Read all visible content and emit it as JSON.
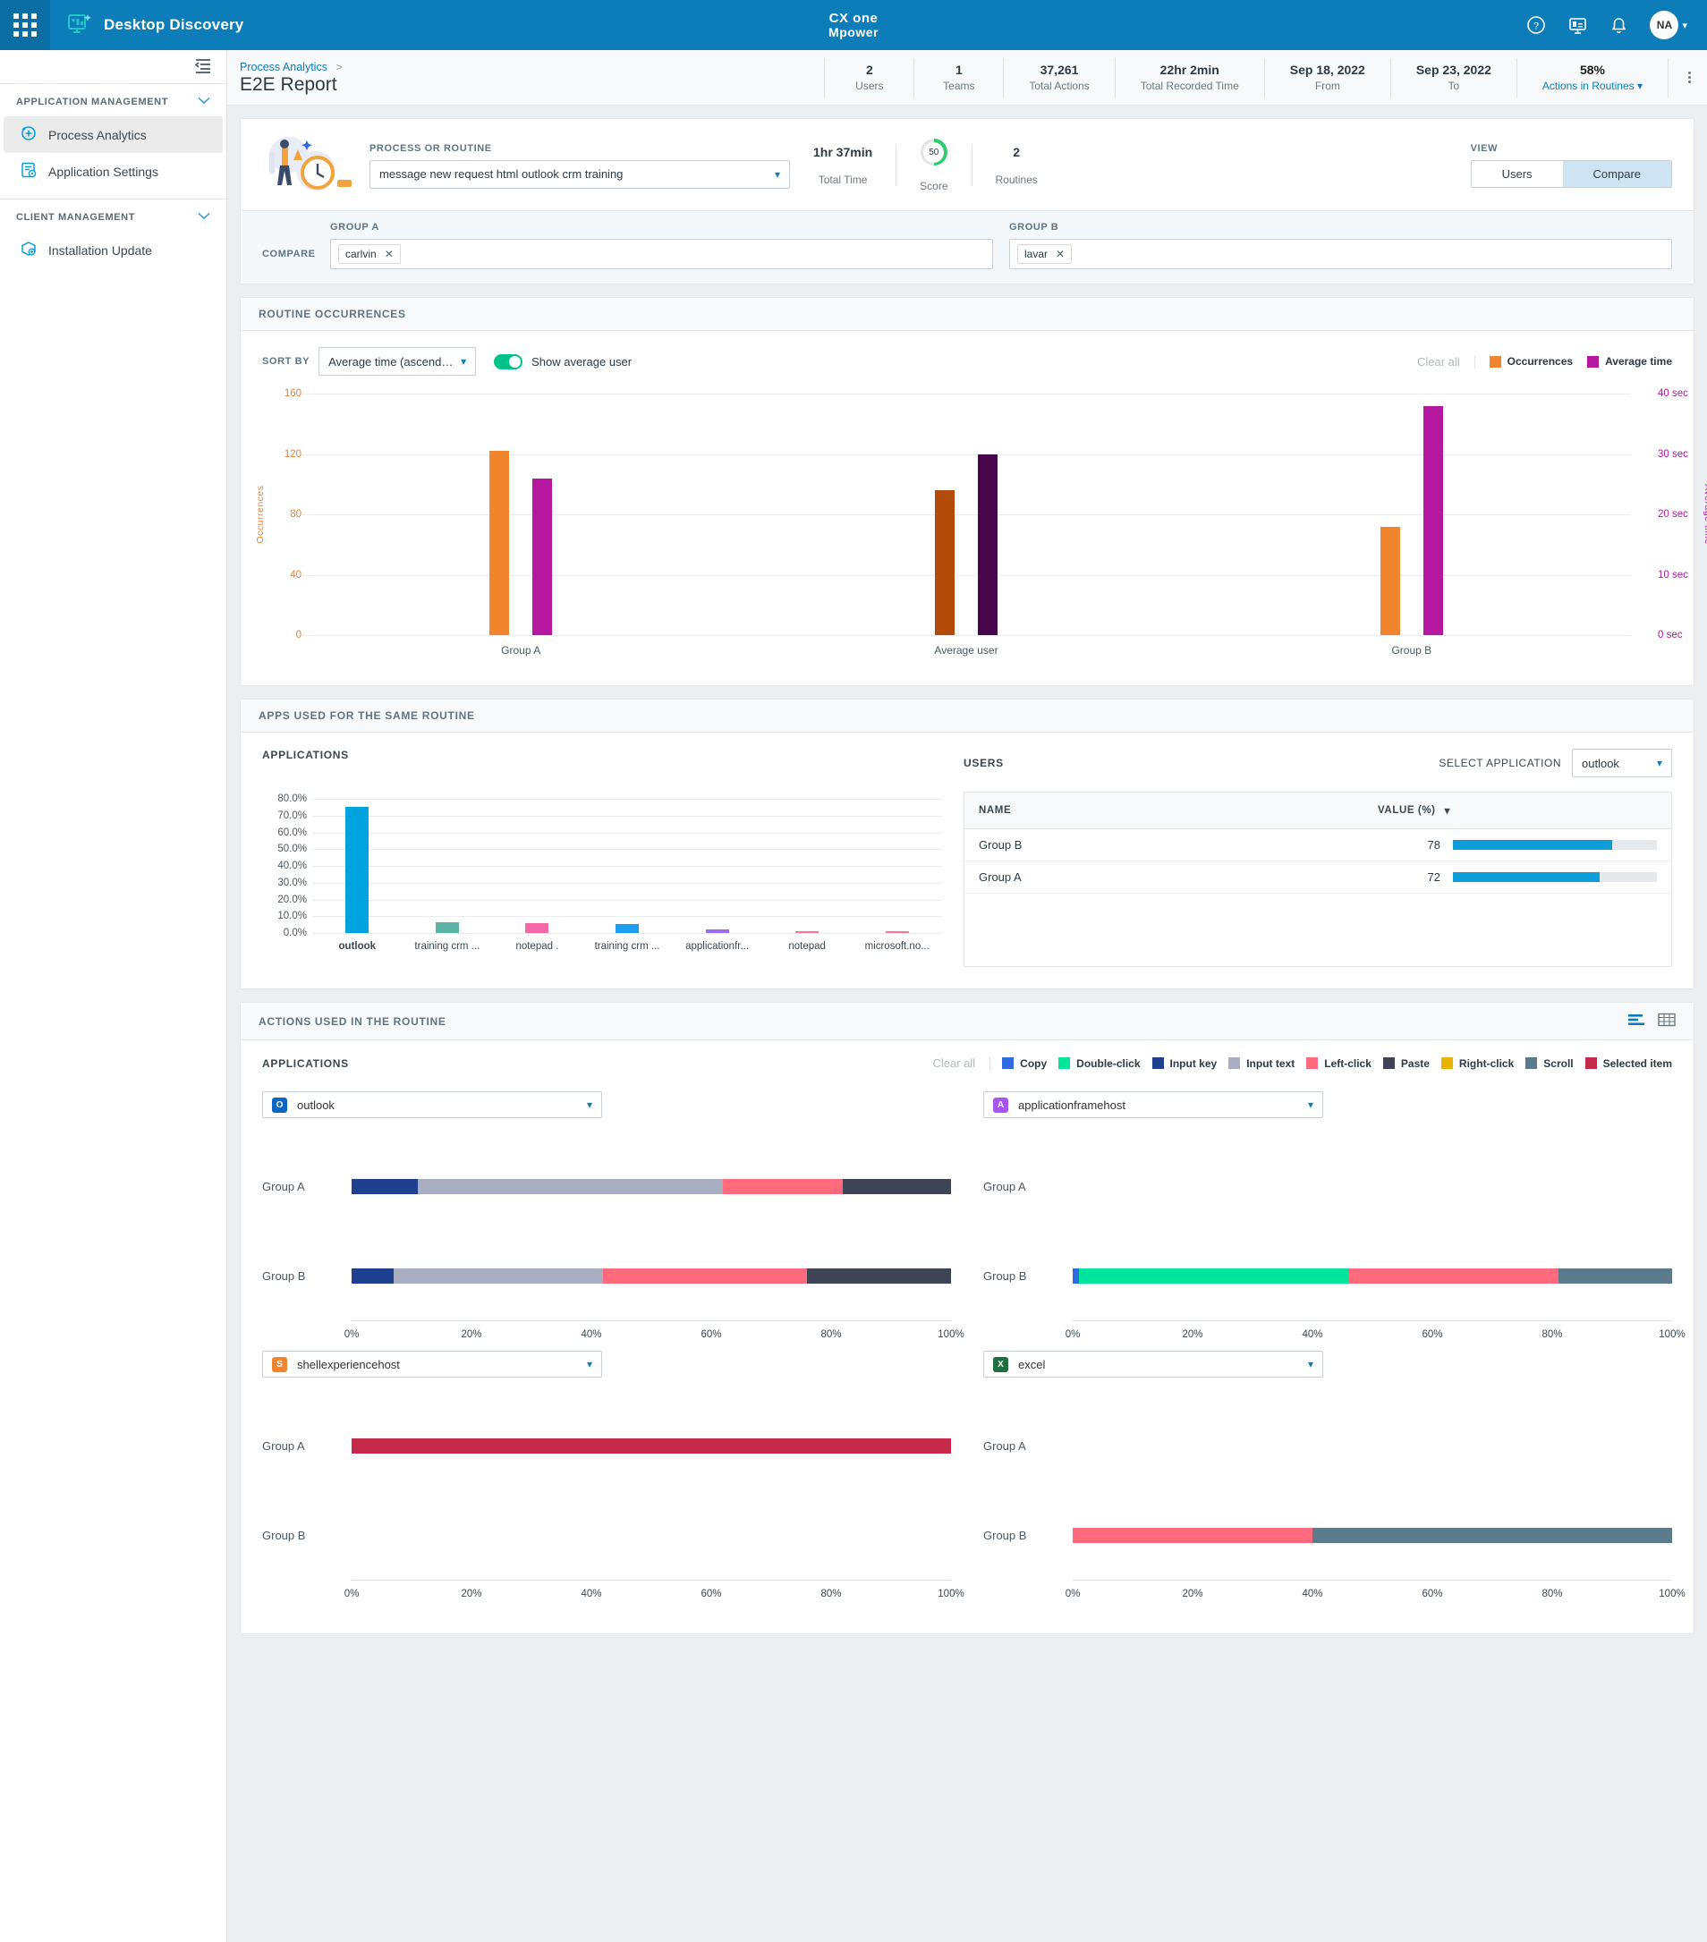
{
  "topbar": {
    "app_name": "Desktop Discovery",
    "brand_line1": "CX one",
    "brand_line2": "Mpower",
    "avatar_initials": "NA",
    "icons": [
      "waffle-icon",
      "help-icon",
      "presentation-icon",
      "bell-icon"
    ]
  },
  "sidebar": {
    "sections": [
      {
        "label": "APPLICATION MANAGEMENT",
        "items": [
          {
            "label": "Process Analytics",
            "active": true
          },
          {
            "label": "Application Settings",
            "active": false
          }
        ]
      },
      {
        "label": "CLIENT MANAGEMENT",
        "items": [
          {
            "label": "Installation Update",
            "active": false
          }
        ]
      }
    ]
  },
  "breadcrumb": {
    "parent": "Process Analytics",
    "separator": ">",
    "title": "E2E Report"
  },
  "stats": [
    {
      "value": "2",
      "label": "Users"
    },
    {
      "value": "1",
      "label": "Teams"
    },
    {
      "value": "37,261",
      "label": "Total Actions"
    },
    {
      "value": "22hr 2min",
      "label": "Total Recorded Time"
    },
    {
      "value": "Sep 18, 2022",
      "label": "From"
    },
    {
      "value": "Sep 23, 2022",
      "label": "To"
    },
    {
      "value": "58%",
      "label": "Actions in Routines"
    }
  ],
  "picker": {
    "field_label": "PROCESS OR ROUTINE",
    "selected": "message new request html outlook crm training",
    "metrics": [
      {
        "value": "1hr 37min",
        "label": "Total Time"
      },
      {
        "value": "50",
        "label": "Score"
      },
      {
        "value": "2",
        "label": "Routines"
      }
    ],
    "view_label": "VIEW",
    "view_options": [
      "Users",
      "Compare"
    ],
    "view_selected": "Compare",
    "compare_label": "COMPARE",
    "group_a_label": "GROUP A",
    "group_b_label": "GROUP B",
    "group_a_chips": [
      "carlvin"
    ],
    "group_b_chips": [
      "lavar"
    ]
  },
  "occurrences": {
    "title": "ROUTINE OCCURRENCES",
    "sort_label": "SORT BY",
    "sort_value": "Average time (ascending)",
    "toggle_label": "Show average user",
    "toggle_on": true,
    "clear_all": "Clear all",
    "legend": [
      {
        "label": "Occurrences",
        "color": "#f0852e"
      },
      {
        "label": "Average time",
        "color": "#b5179e"
      }
    ]
  },
  "apps_used": {
    "title": "APPS USED FOR THE SAME ROUTINE",
    "applications_label": "APPLICATIONS",
    "users_label": "USERS",
    "select_application_label": "SELECT APPLICATION",
    "select_application_value": "outlook",
    "table": {
      "columns": [
        "NAME",
        "VALUE (%)"
      ],
      "rows": [
        {
          "name": "Group B",
          "value": "78",
          "pct": 78
        },
        {
          "name": "Group A",
          "value": "72",
          "pct": 72
        }
      ]
    }
  },
  "actions_used": {
    "title": "ACTIONS USED IN THE ROUTINE",
    "applications_label": "APPLICATIONS",
    "clear_all": "Clear all",
    "legend": [
      {
        "label": "Copy",
        "color": "#2f6ae3"
      },
      {
        "label": "Double-click",
        "color": "#00e39a"
      },
      {
        "label": "Input key",
        "color": "#1f3f8f"
      },
      {
        "label": "Input text",
        "color": "#a9adc0"
      },
      {
        "label": "Left-click",
        "color": "#ff6b7d"
      },
      {
        "label": "Paste",
        "color": "#3f4455"
      },
      {
        "label": "Right-click",
        "color": "#e8b400"
      },
      {
        "label": "Scroll",
        "color": "#5b7a8c"
      },
      {
        "label": "Selected item",
        "color": "#c62a4b"
      }
    ],
    "view_icons": [
      "bar-view-icon",
      "grid-view-icon"
    ],
    "group_a_label": "Group A",
    "group_b_label": "Group B"
  },
  "chart_data": [
    {
      "type": "bar",
      "id": "routine-occurrences",
      "title": "ROUTINE OCCURRENCES",
      "categories": [
        "Group A",
        "Average user",
        "Group B"
      ],
      "series": [
        {
          "name": "Occurrences",
          "axis": "left",
          "color": "#f0852e",
          "values": [
            122,
            96,
            72
          ],
          "colors": [
            "#f0852e",
            "#b24a09",
            "#f0852e"
          ]
        },
        {
          "name": "Average time",
          "axis": "right",
          "color": "#b5179e",
          "values": [
            26.0,
            30.0,
            38.0
          ],
          "colors": [
            "#b5179e",
            "#47064b",
            "#b5179e"
          ]
        }
      ],
      "ylabel": "Occurrences",
      "ylim": [
        0,
        160
      ],
      "yticks": [
        "0",
        "40",
        "80",
        "120",
        "160"
      ],
      "y2label": "Average time",
      "y2lim": [
        0,
        40
      ],
      "y2ticks": [
        "0 sec",
        "10 sec",
        "20 sec",
        "30 sec",
        "40 sec"
      ],
      "grid": true,
      "legend_position": "top-right"
    },
    {
      "type": "bar",
      "id": "applications-usage",
      "title": "APPLICATIONS",
      "categories": [
        "outlook",
        "training crm ...",
        "notepad .",
        "training crm ...",
        "applicationfr...",
        "notepad",
        "microsoft.no..."
      ],
      "values": [
        75.0,
        6.2,
        5.7,
        5.2,
        2.3,
        0.5,
        0.5
      ],
      "colors": [
        "#00a3dd",
        "#5bb3a6",
        "#f768a6",
        "#1e9ef0",
        "#9b6cf0",
        "#f4798f",
        "#f4798f"
      ],
      "ylabel": "",
      "ylim": [
        0,
        80
      ],
      "yticks": [
        "0.0%",
        "10.0%",
        "20.0%",
        "30.0%",
        "40.0%",
        "50.0%",
        "60.0%",
        "70.0%",
        "80.0%"
      ],
      "grid": true
    },
    {
      "type": "bar",
      "id": "users-value-table",
      "title": "USERS",
      "categories": [
        "Group B",
        "Group A"
      ],
      "values": [
        78,
        72
      ],
      "ylim": [
        0,
        100
      ]
    },
    {
      "type": "bar",
      "id": "actions-outlook",
      "title": "outlook",
      "orientation": "horizontal",
      "stacked": true,
      "categories": [
        "Group A",
        "Group B"
      ],
      "xticks": [
        "0%",
        "20%",
        "40%",
        "60%",
        "80%",
        "100%"
      ],
      "series": [
        {
          "name": "Input key",
          "color": "#1f3f8f",
          "values": [
            11,
            7
          ]
        },
        {
          "name": "Input text",
          "color": "#a9adc0",
          "values": [
            51,
            35
          ]
        },
        {
          "name": "Left-click",
          "color": "#ff6b7d",
          "values": [
            20,
            34
          ]
        },
        {
          "name": "Paste",
          "color": "#3f4455",
          "values": [
            18,
            24
          ]
        }
      ]
    },
    {
      "type": "bar",
      "id": "actions-applicationframehost",
      "title": "applicationframehost",
      "orientation": "horizontal",
      "stacked": true,
      "categories": [
        "Group A",
        "Group B"
      ],
      "xticks": [
        "0%",
        "20%",
        "40%",
        "60%",
        "80%",
        "100%"
      ],
      "series": [
        {
          "name": "Copy",
          "color": "#2f6ae3",
          "values": [
            0,
            1
          ]
        },
        {
          "name": "Double-click",
          "color": "#00e39a",
          "values": [
            0,
            45
          ]
        },
        {
          "name": "Left-click",
          "color": "#ff6b7d",
          "values": [
            0,
            35
          ]
        },
        {
          "name": "Scroll",
          "color": "#5b7a8c",
          "values": [
            0,
            19
          ]
        }
      ]
    },
    {
      "type": "bar",
      "id": "actions-shellexperiencehost",
      "title": "shellexperiencehost",
      "orientation": "horizontal",
      "stacked": true,
      "categories": [
        "Group A",
        "Group B"
      ],
      "xticks": [
        "0%",
        "20%",
        "40%",
        "60%",
        "80%",
        "100%"
      ],
      "series": [
        {
          "name": "Selected item",
          "color": "#c62a4b",
          "values": [
            100,
            0
          ]
        }
      ]
    },
    {
      "type": "bar",
      "id": "actions-excel",
      "title": "excel",
      "orientation": "horizontal",
      "stacked": true,
      "categories": [
        "Group A",
        "Group B"
      ],
      "xticks": [
        "0%",
        "20%",
        "40%",
        "60%",
        "80%",
        "100%"
      ],
      "series": [
        {
          "name": "Left-click",
          "color": "#ff6b7d",
          "values": [
            0,
            40
          ]
        },
        {
          "name": "Scroll",
          "color": "#5b7a8c",
          "values": [
            0,
            60
          ]
        }
      ]
    }
  ],
  "action_apps": [
    {
      "name": "outlook",
      "icon_letter": "O",
      "icon_color": "#0a66c2",
      "chart": 3
    },
    {
      "name": "applicationframehost",
      "icon_letter": "A",
      "icon_color": "#a855f7",
      "chart": 4
    },
    {
      "name": "shellexperiencehost",
      "icon_letter": "S",
      "icon_color": "#f0852e",
      "chart": 5
    },
    {
      "name": "excel",
      "icon_letter": "X",
      "icon_color": "#1d6f42",
      "chart": 6
    }
  ]
}
